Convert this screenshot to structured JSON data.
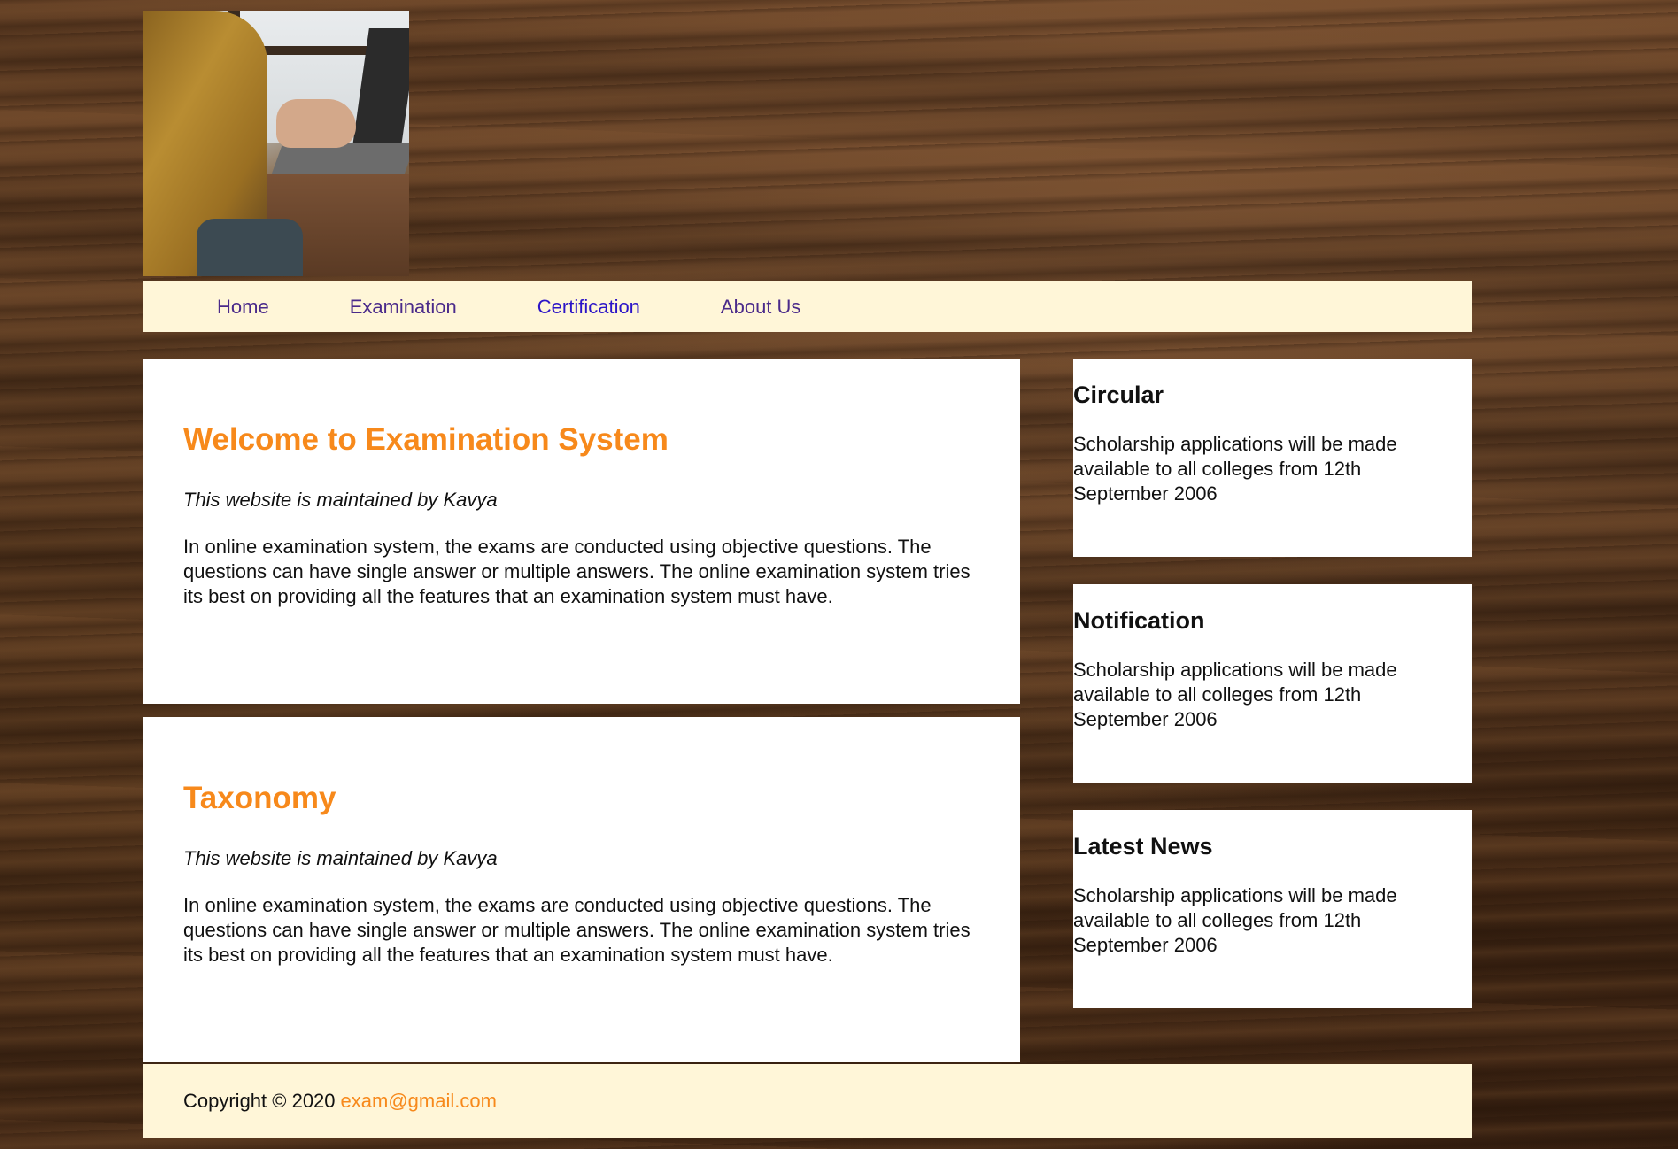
{
  "header": {
    "image_icon": "laptop-typing-photo"
  },
  "nav": {
    "items": [
      {
        "label": "Home"
      },
      {
        "label": "Examination"
      },
      {
        "label": "Certification"
      },
      {
        "label": "About Us"
      }
    ]
  },
  "articles": [
    {
      "title": "Welcome to Examination System",
      "byline": "This website is maintained by Kavya",
      "body": "In online examination system, the exams are conducted using objective questions. The questions can have single answer or multiple answers. The online examination system tries its best on providing all the features that an examination system must have."
    },
    {
      "title": "Taxonomy",
      "byline": "This website is maintained by Kavya",
      "body": "In online examination system, the exams are conducted using objective questions. The questions can have single answer or multiple answers. The online examination system tries its best on providing all the features that an examination system must have."
    }
  ],
  "sidebar": {
    "boxes": [
      {
        "title": "Circular",
        "text": "Scholarship applications will be made available to all colleges from 12th September 2006"
      },
      {
        "title": "Notification",
        "text": "Scholarship applications will be made available to all colleges from 12th September 2006"
      },
      {
        "title": "Latest News",
        "text": "Scholarship applications will be made available to all colleges from 12th September 2006"
      }
    ]
  },
  "footer": {
    "copyright": "Copyright © 2020",
    "email": "exam@gmail.com"
  },
  "colors": {
    "accent": "#f7891b",
    "nav_bg": "#fff6d8",
    "nav_link": "#4a2a8a",
    "nav_link_visited": "#2b14c7"
  }
}
